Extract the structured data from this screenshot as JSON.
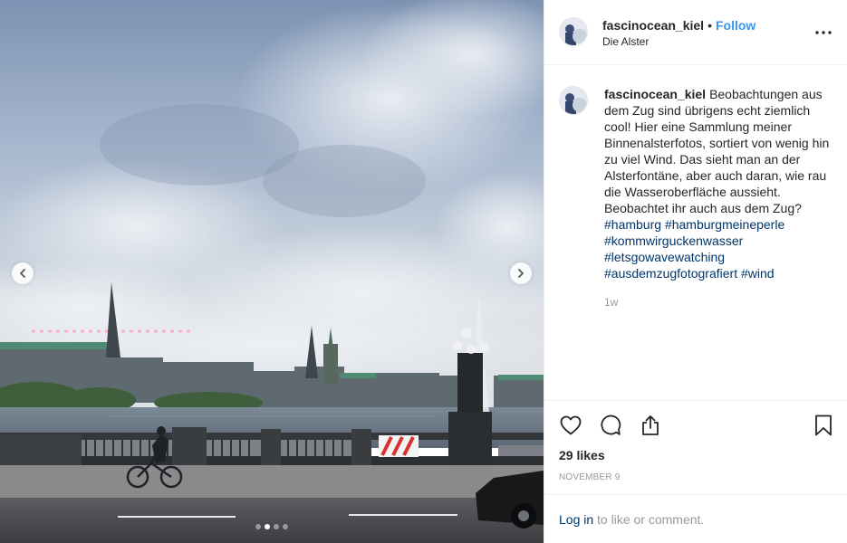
{
  "post": {
    "username": "fascinocean_kiel",
    "separator": "•",
    "follow_label": "Follow",
    "location": "Die Alster",
    "more_icon": "more-horizontal-icon",
    "caption_text": "Beobachtungen aus dem Zug sind übrigens echt ziemlich cool! Hier eine Sammlung meiner Binnenalsterfotos, sortiert von wenig hin zu viel Wind. Das sieht man an der Alsterfontäne, aber auch daran, wie rau die Wasseroberfläche aussieht. Beobachtet ihr auch aus dem Zug?",
    "hashtags": [
      "#hamburg",
      "#hamburgmeineperle",
      "#kommwirguckenwasser",
      "#letsgowavewatching",
      "#ausdemzugfotografiert",
      "#wind"
    ],
    "time_ago": "1w",
    "likes": "29 likes",
    "date": "November 9",
    "login_link": "Log in",
    "login_suffix": "to like or comment.",
    "carousel": {
      "slide_count": 4,
      "active_index": 1
    },
    "icons": {
      "like": "heart-icon",
      "comment": "comment-icon",
      "share": "share-icon",
      "save": "bookmark-icon",
      "prev": "chevron-left-icon",
      "next": "chevron-right-icon"
    },
    "colors": {
      "link_blue": "#3897f0",
      "hashtag_blue": "#003569",
      "muted_gray": "#999999",
      "text": "#262626",
      "divider": "#efefef"
    }
  }
}
